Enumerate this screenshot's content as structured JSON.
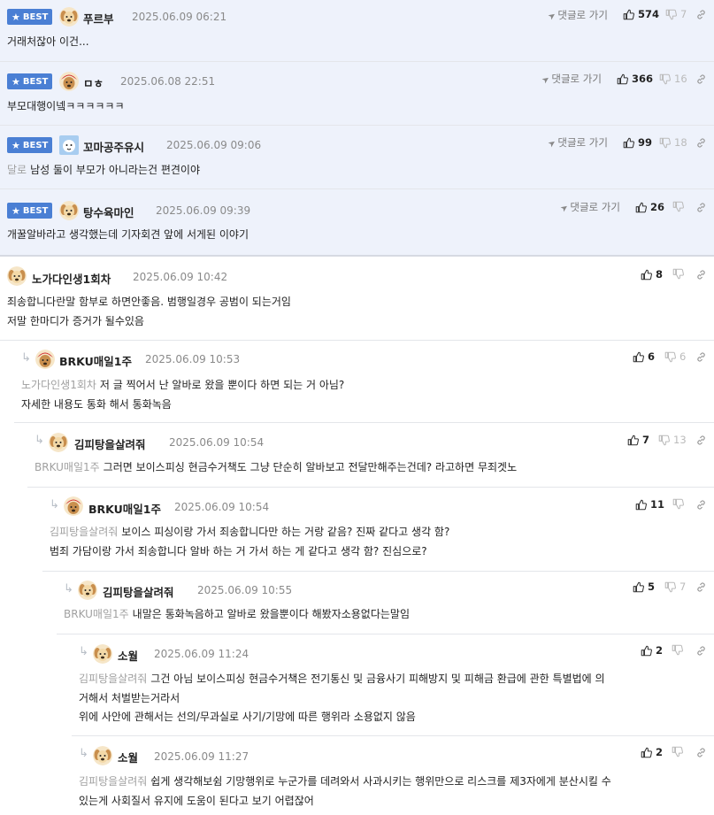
{
  "ui": {
    "reply_label": "댓글로 가기",
    "best_label": "BEST"
  },
  "comments": [
    {
      "nick": "푸르부",
      "date": "2025.06.09 06:21",
      "up": "574",
      "down": "7",
      "lines": [
        "거래처잖아 이건..."
      ]
    },
    {
      "nick": "ㅁㅎ",
      "date": "2025.06.08 22:51",
      "up": "366",
      "down": "16",
      "lines": [
        "부모대행이넼ㅋㅋㅋㅋㅋㅋ"
      ]
    },
    {
      "nick": "꼬마공주유시",
      "date": "2025.06.09 09:06",
      "up": "99",
      "down": "18",
      "mention": "달로",
      "lines": [
        "남성 둘이 부모가 아니라는건 편견이야"
      ]
    },
    {
      "nick": "탕수육마인",
      "date": "2025.06.09 09:39",
      "up": "26",
      "down": "",
      "lines": [
        "개꿀알바라고 생각했는데 기자회견 앞에 서게된 이야기"
      ]
    },
    {
      "nick": "노가다인생1회차",
      "date": "2025.06.09 10:42",
      "up": "8",
      "down": "",
      "lines": [
        "죄송합니다란말 함부로 하면안좋음. 범행일경우 공범이 되는거임",
        "저말 한마디가 증거가 될수있음"
      ]
    },
    {
      "nick": "BRKU매일1주",
      "date": "2025.06.09 10:53",
      "up": "6",
      "down": "6",
      "mention": "노가다인생1회차",
      "lines": [
        "저 글 찍어서 난 알바로 왔을 뿐이다 하면 되는 거 아님?",
        "자세한 내용도 통화 해서 통화녹음"
      ]
    },
    {
      "nick": "김피탕을살려줘",
      "date": "2025.06.09 10:54",
      "up": "7",
      "down": "13",
      "mention": "BRKU매일1주",
      "lines": [
        "그러면 보이스피싱 현금수거책도 그냥 단순히 알바보고 전달만해주는건데? 라고하면 무죄겟노"
      ]
    },
    {
      "nick": "BRKU매일1주",
      "date": "2025.06.09 10:54",
      "up": "11",
      "down": "",
      "mention": "김피탕을살려줘",
      "lines": [
        "보이스 피싱이랑 가서 죄송합니다만 하는 거랑 같음? 진짜 같다고 생각 함?",
        "범죄 가담이랑 가서 죄송합니다 알바 하는 거 가서 하는 게 같다고 생각 함? 진심으로?"
      ]
    },
    {
      "nick": "김피탕을살려줘",
      "date": "2025.06.09 10:55",
      "up": "5",
      "down": "7",
      "mention": "BRKU매일1주",
      "lines": [
        "내말은 통화녹음하고 알바로 왔을뿐이다 해봤자소용없다는말임"
      ]
    },
    {
      "nick": "소월",
      "date": "2025.06.09 11:24",
      "up": "2",
      "down": "",
      "mention": "김피탕을살려줘",
      "lines": [
        "그건 아님 보이스피싱 현금수거책은 전기통신 및 금융사기 피해방지 및 피해금 환급에 관한 특별법에 의",
        "거해서 처벌받는거라서",
        "위에 사안에 관해서는 선의/무과실로 사기/기망에 따른 행위라 소용없지 않음"
      ]
    },
    {
      "nick": "소월",
      "date": "2025.06.09 11:27",
      "up": "2",
      "down": "",
      "mention": "김피탕을살려줘",
      "lines": [
        "쉽게 생각해보쉼 기망행위로 누군가를 데려와서 사과시키는 행위만으로 리스크를 제3자에게 분산시킬 수",
        "있는게 사회질서 유지에 도움이 된다고 보기 어렵잖어"
      ]
    }
  ]
}
